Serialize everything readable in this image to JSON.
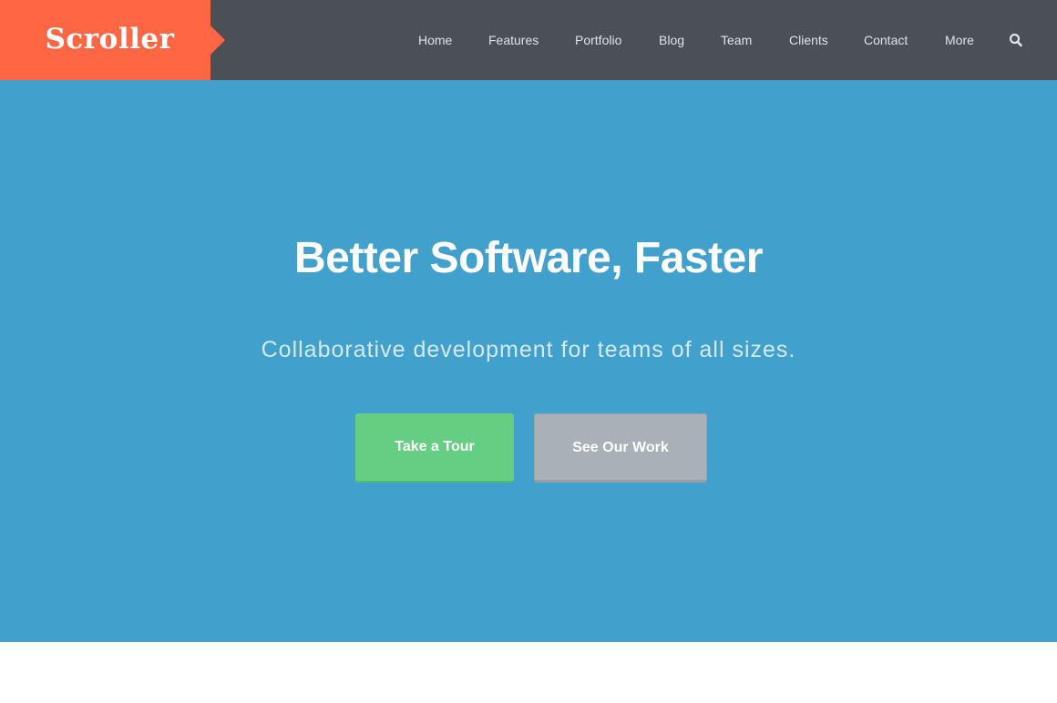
{
  "brand": {
    "name": "Scroller",
    "colors": {
      "accent": "#ff6644",
      "header_bg": "#4a5055",
      "hero_bg": "#41a0cc",
      "primary_button": "#65ce83",
      "secondary_button": "#aab0b8"
    }
  },
  "nav": {
    "items": [
      {
        "label": "Home"
      },
      {
        "label": "Features"
      },
      {
        "label": "Portfolio"
      },
      {
        "label": "Blog"
      },
      {
        "label": "Team"
      },
      {
        "label": "Clients"
      },
      {
        "label": "Contact"
      },
      {
        "label": "More"
      }
    ],
    "search_icon": "search-icon"
  },
  "hero": {
    "title": "Better Software, Faster",
    "subtitle": "Collaborative development for teams of all sizes.",
    "primary_button": "Take a Tour",
    "secondary_button": "See Our Work"
  }
}
